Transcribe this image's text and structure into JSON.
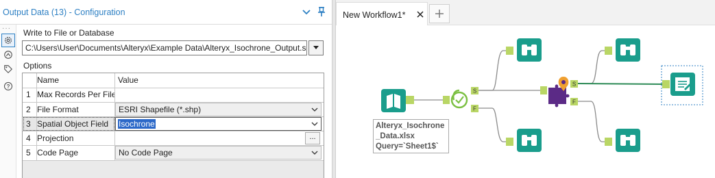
{
  "config": {
    "title": "Output Data (13) - Configuration",
    "write_label": "Write to File or Database",
    "file_path": "C:\\Users\\User\\Documents\\Alteryx\\Example Data\\Alteryx_Isochrone_Output.shp",
    "options_label": "Options",
    "grid": {
      "col_name": "Name",
      "col_value": "Value",
      "rows": [
        {
          "num": "1",
          "name": "Max Records Per File",
          "value": ""
        },
        {
          "num": "2",
          "name": "File Format",
          "value": "ESRI Shapefile (*.shp)"
        },
        {
          "num": "3",
          "name": "Spatial Object Field",
          "value": "Isochrone"
        },
        {
          "num": "4",
          "name": "Projection",
          "value": ""
        },
        {
          "num": "5",
          "name": "Code Page",
          "value": "No Code Page"
        }
      ],
      "ellipsis": "..."
    }
  },
  "canvas": {
    "tab_title": "New Workflow1*",
    "input_caption": [
      "Alteryx_Isochrone",
      "_Data.xlsx",
      "Query=`Sheet1$`"
    ],
    "anchors": {
      "s": "S",
      "f": "F"
    }
  },
  "colors": {
    "accent": "#2c7fc3",
    "tool_teal": "#1a9d8c",
    "spatial_green": "#7cc043",
    "spatial_purple": "#5b2a86",
    "spatial_orange": "#f0a030",
    "anchor_green": "#b9d665",
    "selected_text": "#2b68c8"
  }
}
